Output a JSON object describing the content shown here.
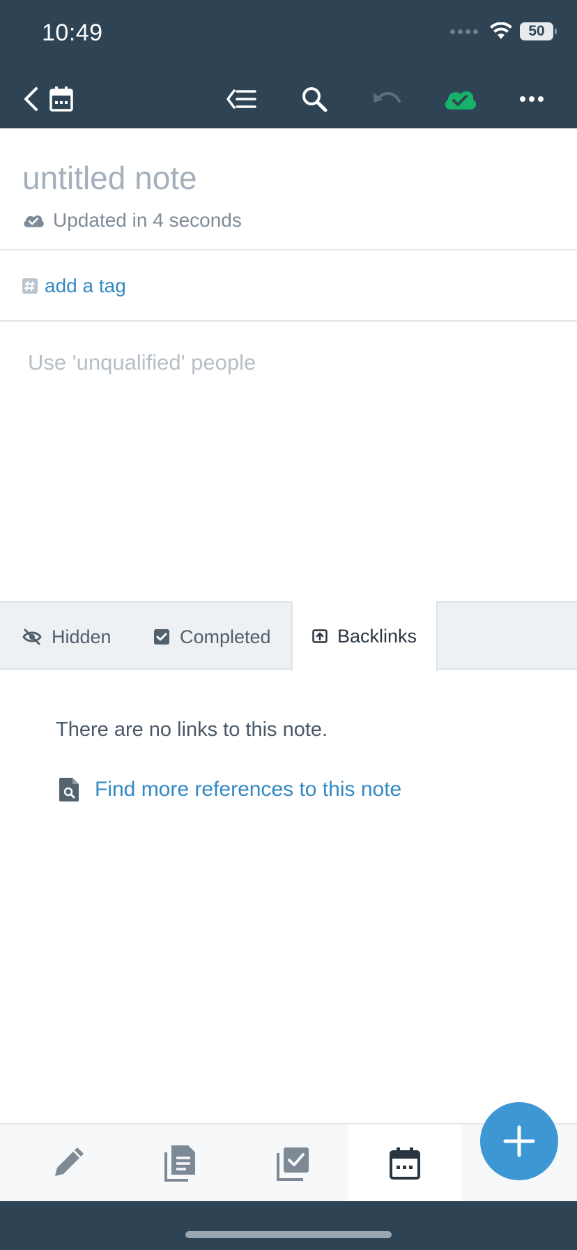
{
  "status_bar": {
    "time": "10:49",
    "battery": "50"
  },
  "toolbar": {
    "back_icon": "chevron-left-icon",
    "calendar_icon": "calendar-icon",
    "outline_icon": "outline-collapse-icon",
    "search_icon": "search-icon",
    "undo_icon": "undo-icon",
    "sync_icon": "cloud-check-icon",
    "more_icon": "more-horizontal-icon",
    "sync_color": "#17b26a"
  },
  "note": {
    "title": "untitled note",
    "updated_text": "Updated in 4 seconds",
    "tag_placeholder": "add a tag",
    "body_text": "Use 'unqualified' people"
  },
  "tabs": [
    {
      "label": "Hidden",
      "icon": "eye-slash-icon"
    },
    {
      "label": "Completed",
      "icon": "checkbox-checked-icon"
    },
    {
      "label": "Backlinks",
      "icon": "backlink-icon",
      "active": true
    }
  ],
  "backlinks": {
    "empty_text": "There are no links to this note.",
    "find_more_label": "Find more references to this note"
  },
  "bottom_nav": [
    {
      "name": "pencil-icon"
    },
    {
      "name": "notes-icon"
    },
    {
      "name": "tasks-icon"
    },
    {
      "name": "calendar-icon",
      "active": true
    }
  ],
  "fab": {
    "icon": "plus-icon"
  },
  "colors": {
    "header": "#2e4455",
    "accent": "#3489c4",
    "fab": "#3d97d3"
  }
}
